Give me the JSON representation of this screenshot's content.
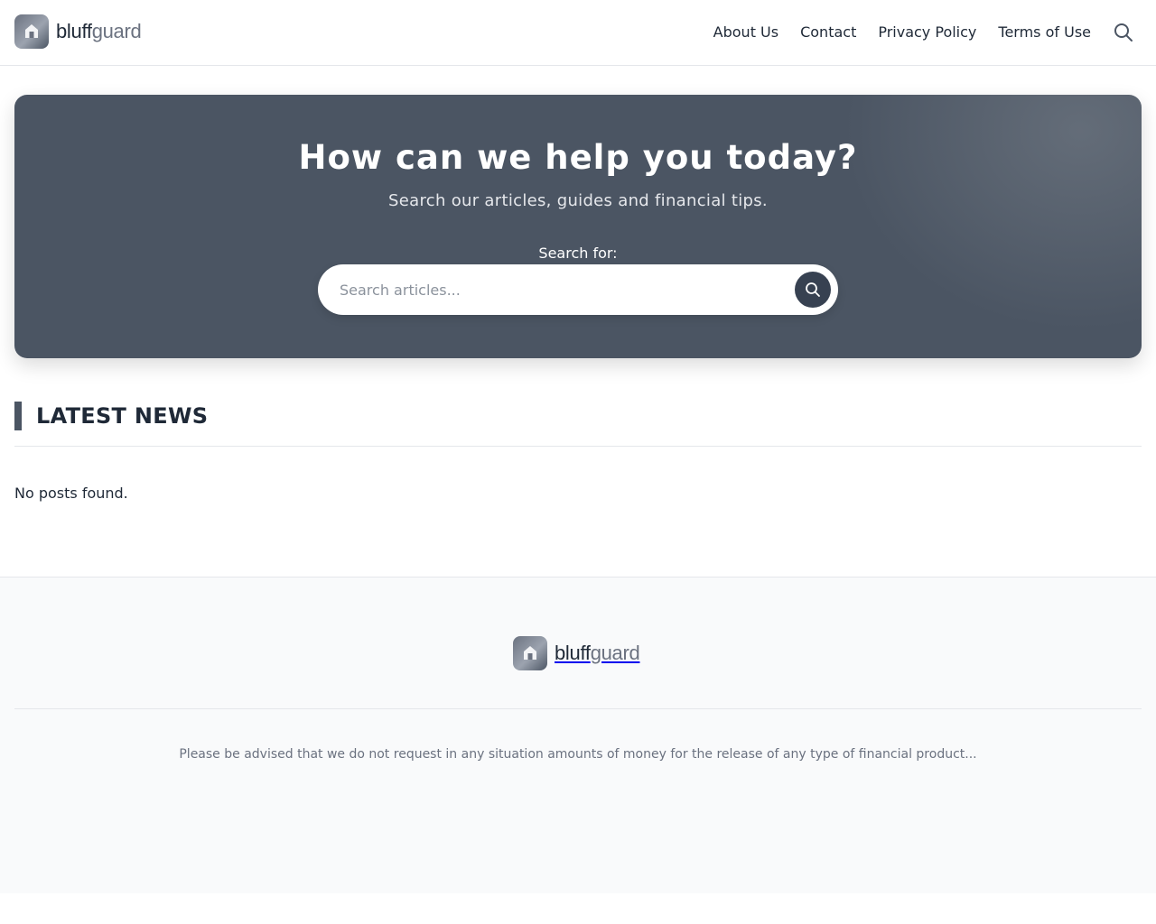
{
  "brand": {
    "name_part1": "bluff",
    "name_part2": "guard",
    "logo_icon": "house-icon",
    "accent": "#4b5563"
  },
  "nav": {
    "items": [
      {
        "label": "About Us"
      },
      {
        "label": "Contact"
      },
      {
        "label": "Privacy Policy"
      },
      {
        "label": "Terms of Use"
      }
    ],
    "search_icon": "search-icon"
  },
  "hero": {
    "title": "How can we help you today?",
    "subtitle": "Search our articles, guides and financial tips.",
    "search_label": "Search for:",
    "search_placeholder": "Search articles...",
    "search_value": "",
    "submit_icon": "search-icon",
    "background": "#4b5563"
  },
  "latest": {
    "title": "LATEST NEWS",
    "empty_message": "No posts found."
  },
  "footer": {
    "disclaimer": "Please be advised that we do not request in any situation amounts of money for the release of any type of financial product...",
    "background": "#f9fafb"
  }
}
